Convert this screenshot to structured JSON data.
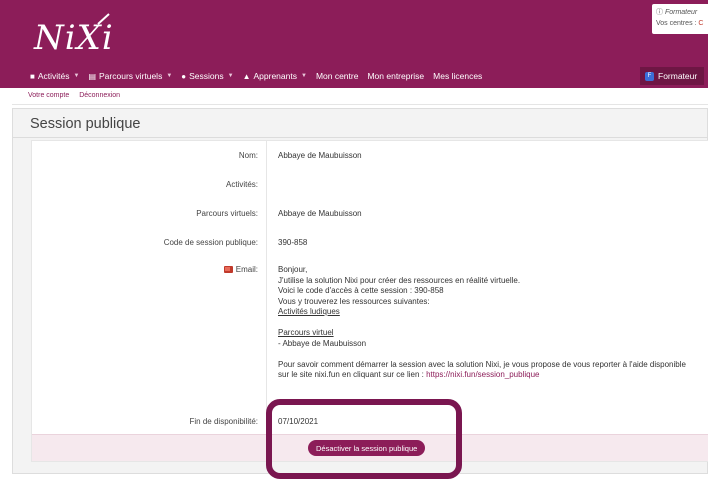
{
  "brand": {
    "logo_text": "NiXi"
  },
  "info": {
    "line1": "Formateur",
    "line2": "Vos centres :"
  },
  "nav": {
    "items": [
      {
        "label": "Activités",
        "icon": "square-icon",
        "dropdown": true
      },
      {
        "label": "Parcours virtuels",
        "icon": "image-icon",
        "dropdown": true
      },
      {
        "label": "Sessions",
        "icon": "comment-icon",
        "dropdown": true
      },
      {
        "label": "Apprenants",
        "icon": "graduation-cap-icon",
        "dropdown": true
      },
      {
        "label": "Mon centre",
        "dropdown": false
      },
      {
        "label": "Mon entreprise",
        "dropdown": false
      },
      {
        "label": "Mes licences",
        "dropdown": false
      }
    ],
    "user_badge": "F",
    "user_label": "Formateur"
  },
  "subnav": {
    "account": "Votre compte",
    "logout": "Déconnexion"
  },
  "page": {
    "title": "Session publique"
  },
  "fields": {
    "nom_label": "Nom:",
    "nom_value": "Abbaye de Maubuisson",
    "activites_label": "Activités:",
    "activites_value": "",
    "parcours_label": "Parcours virtuels:",
    "parcours_value": "Abbaye de Maubuisson",
    "code_label": "Code de session publique:",
    "code_value": "390-858",
    "email_label": "Email:",
    "fin_label": "Fin de disponibilité:",
    "fin_value": "07/10/2021"
  },
  "email": {
    "l1": "Bonjour,",
    "l2": "J'utilise la solution Nixi pour créer des ressources en réalité virtuelle.",
    "l3": "Voici le code d'accès à cette session : 390-858",
    "l4": "Vous y trouverez les ressources suivantes:",
    "l5": "Activités ludiques",
    "l6": "Parcours virtuel",
    "l7": "- Abbaye de Maubuisson",
    "l8": "Pour savoir comment démarrer la session avec la solution Nixi, je vous propose de vous reporter à l'aide disponible",
    "l9a": "sur le site nixi.fun en cliquant sur ce lien : ",
    "l9b": "https://nixi.fun/session_publique"
  },
  "actions": {
    "deactivate": "Désactiver la session publique"
  },
  "colors": {
    "brand": "#8c1d59",
    "highlight": "#7a1650"
  }
}
